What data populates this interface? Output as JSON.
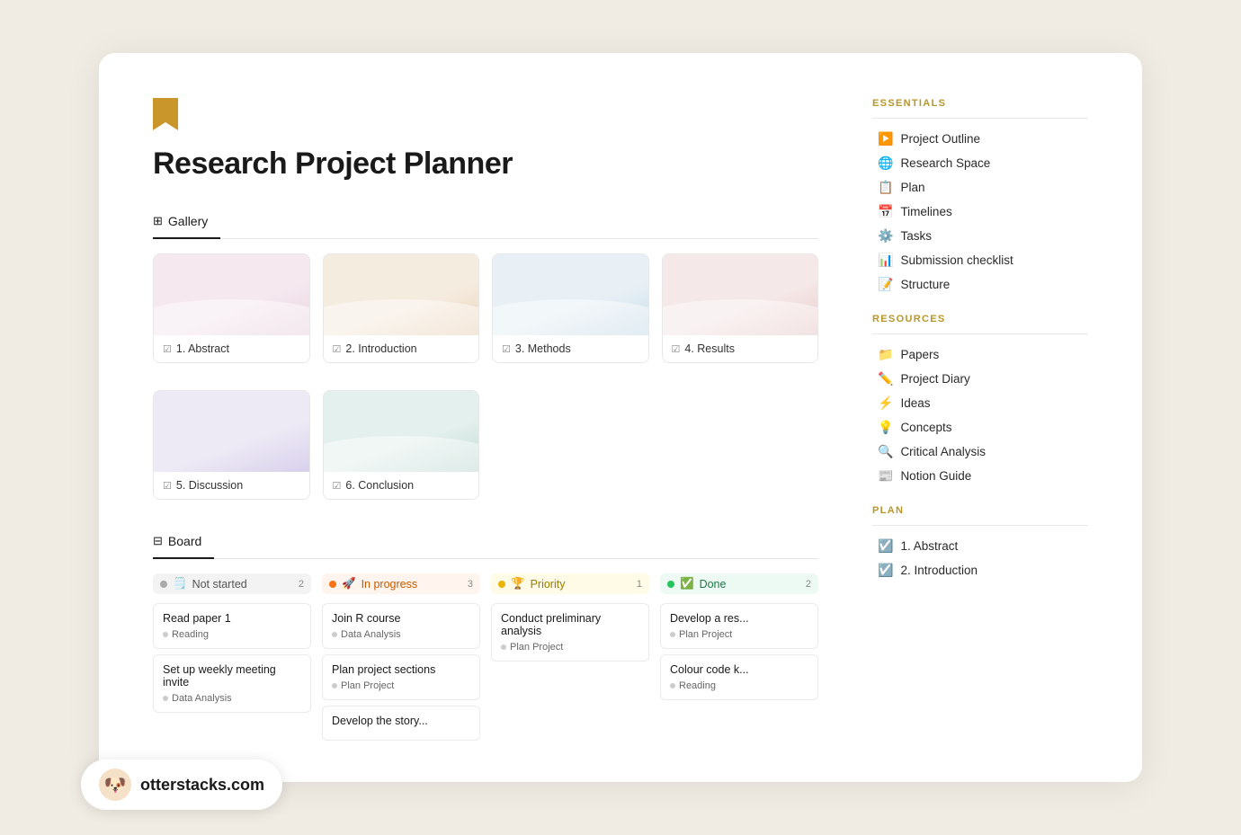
{
  "page": {
    "title": "Research Project Planner",
    "icon": "bookmark"
  },
  "tabs": {
    "gallery_label": "Gallery",
    "board_label": "Board",
    "gallery_icon": "⊞",
    "board_icon": "⊟"
  },
  "gallery": {
    "cards": [
      {
        "id": 1,
        "label": "1. Abstract",
        "thumb_class": "card-thumb-pink card-thumb-wave"
      },
      {
        "id": 2,
        "label": "2. Introduction",
        "thumb_class": "card-thumb-peach card-thumb-wave"
      },
      {
        "id": 3,
        "label": "3. Methods",
        "thumb_class": "card-thumb-blue card-thumb-wave"
      },
      {
        "id": 4,
        "label": "4. Results",
        "thumb_class": "card-thumb-rose card-thumb-wave"
      },
      {
        "id": 5,
        "label": "5. Discussion",
        "thumb_class": "card-thumb-lavender"
      },
      {
        "id": 6,
        "label": "6. Conclusion",
        "thumb_class": "card-thumb-teal card-thumb-wave"
      }
    ]
  },
  "board": {
    "columns": [
      {
        "id": "not-started",
        "label": "Not started",
        "emoji": "🗒️",
        "count": 2,
        "color_class": "col-not-started",
        "dot_class": "dot-gray",
        "cards": [
          {
            "title": "Read paper 1",
            "tag": "Reading"
          },
          {
            "title": "Set up weekly meeting invite",
            "tag": "Data Analysis"
          }
        ]
      },
      {
        "id": "in-progress",
        "label": "In progress",
        "emoji": "🚀",
        "count": 3,
        "color_class": "col-in-progress",
        "dot_class": "dot-orange",
        "cards": [
          {
            "title": "Join R course",
            "tag": "Data Analysis"
          },
          {
            "title": "Plan project sections",
            "tag": "Plan Project"
          },
          {
            "title": "Develop the story...",
            "tag": ""
          }
        ]
      },
      {
        "id": "priority",
        "label": "Priority",
        "emoji": "🏆",
        "count": 1,
        "color_class": "col-priority",
        "dot_class": "dot-yellow",
        "cards": [
          {
            "title": "Conduct preliminary analysis",
            "tag": "Plan Project"
          }
        ]
      },
      {
        "id": "done",
        "label": "Done",
        "emoji": "✅",
        "count": 2,
        "color_class": "col-done",
        "dot_class": "dot-green",
        "cards": [
          {
            "title": "Develop a res...",
            "tag": "Plan Project"
          },
          {
            "title": "Colour code k...",
            "tag": "Reading"
          }
        ]
      }
    ]
  },
  "sidebar": {
    "essentials_title": "ESSENTIALS",
    "resources_title": "RESOURCES",
    "plan_title": "PLAN",
    "essentials_items": [
      {
        "label": "Project Outline",
        "icon": "▶️"
      },
      {
        "label": "Research Space",
        "icon": "🌐"
      },
      {
        "label": "Plan",
        "icon": "📋"
      },
      {
        "label": "Timelines",
        "icon": "📅"
      },
      {
        "label": "Tasks",
        "icon": "⚙️"
      },
      {
        "label": "Submission checklist",
        "icon": "📊"
      },
      {
        "label": "Structure",
        "icon": "📝"
      }
    ],
    "resources_items": [
      {
        "label": "Papers",
        "icon": "📁"
      },
      {
        "label": "Project Diary",
        "icon": "✏️"
      },
      {
        "label": "Ideas",
        "icon": "⚡"
      },
      {
        "label": "Concepts",
        "icon": "💡"
      },
      {
        "label": "Critical Analysis",
        "icon": "🔍"
      },
      {
        "label": "Notion Guide",
        "icon": "📰"
      }
    ],
    "plan_items": [
      {
        "label": "1. Abstract",
        "icon": "☑️"
      },
      {
        "label": "2. Introduction",
        "icon": "☑️"
      }
    ]
  },
  "watermark": {
    "text": "otterstacks.com",
    "avatar": "🐶"
  }
}
